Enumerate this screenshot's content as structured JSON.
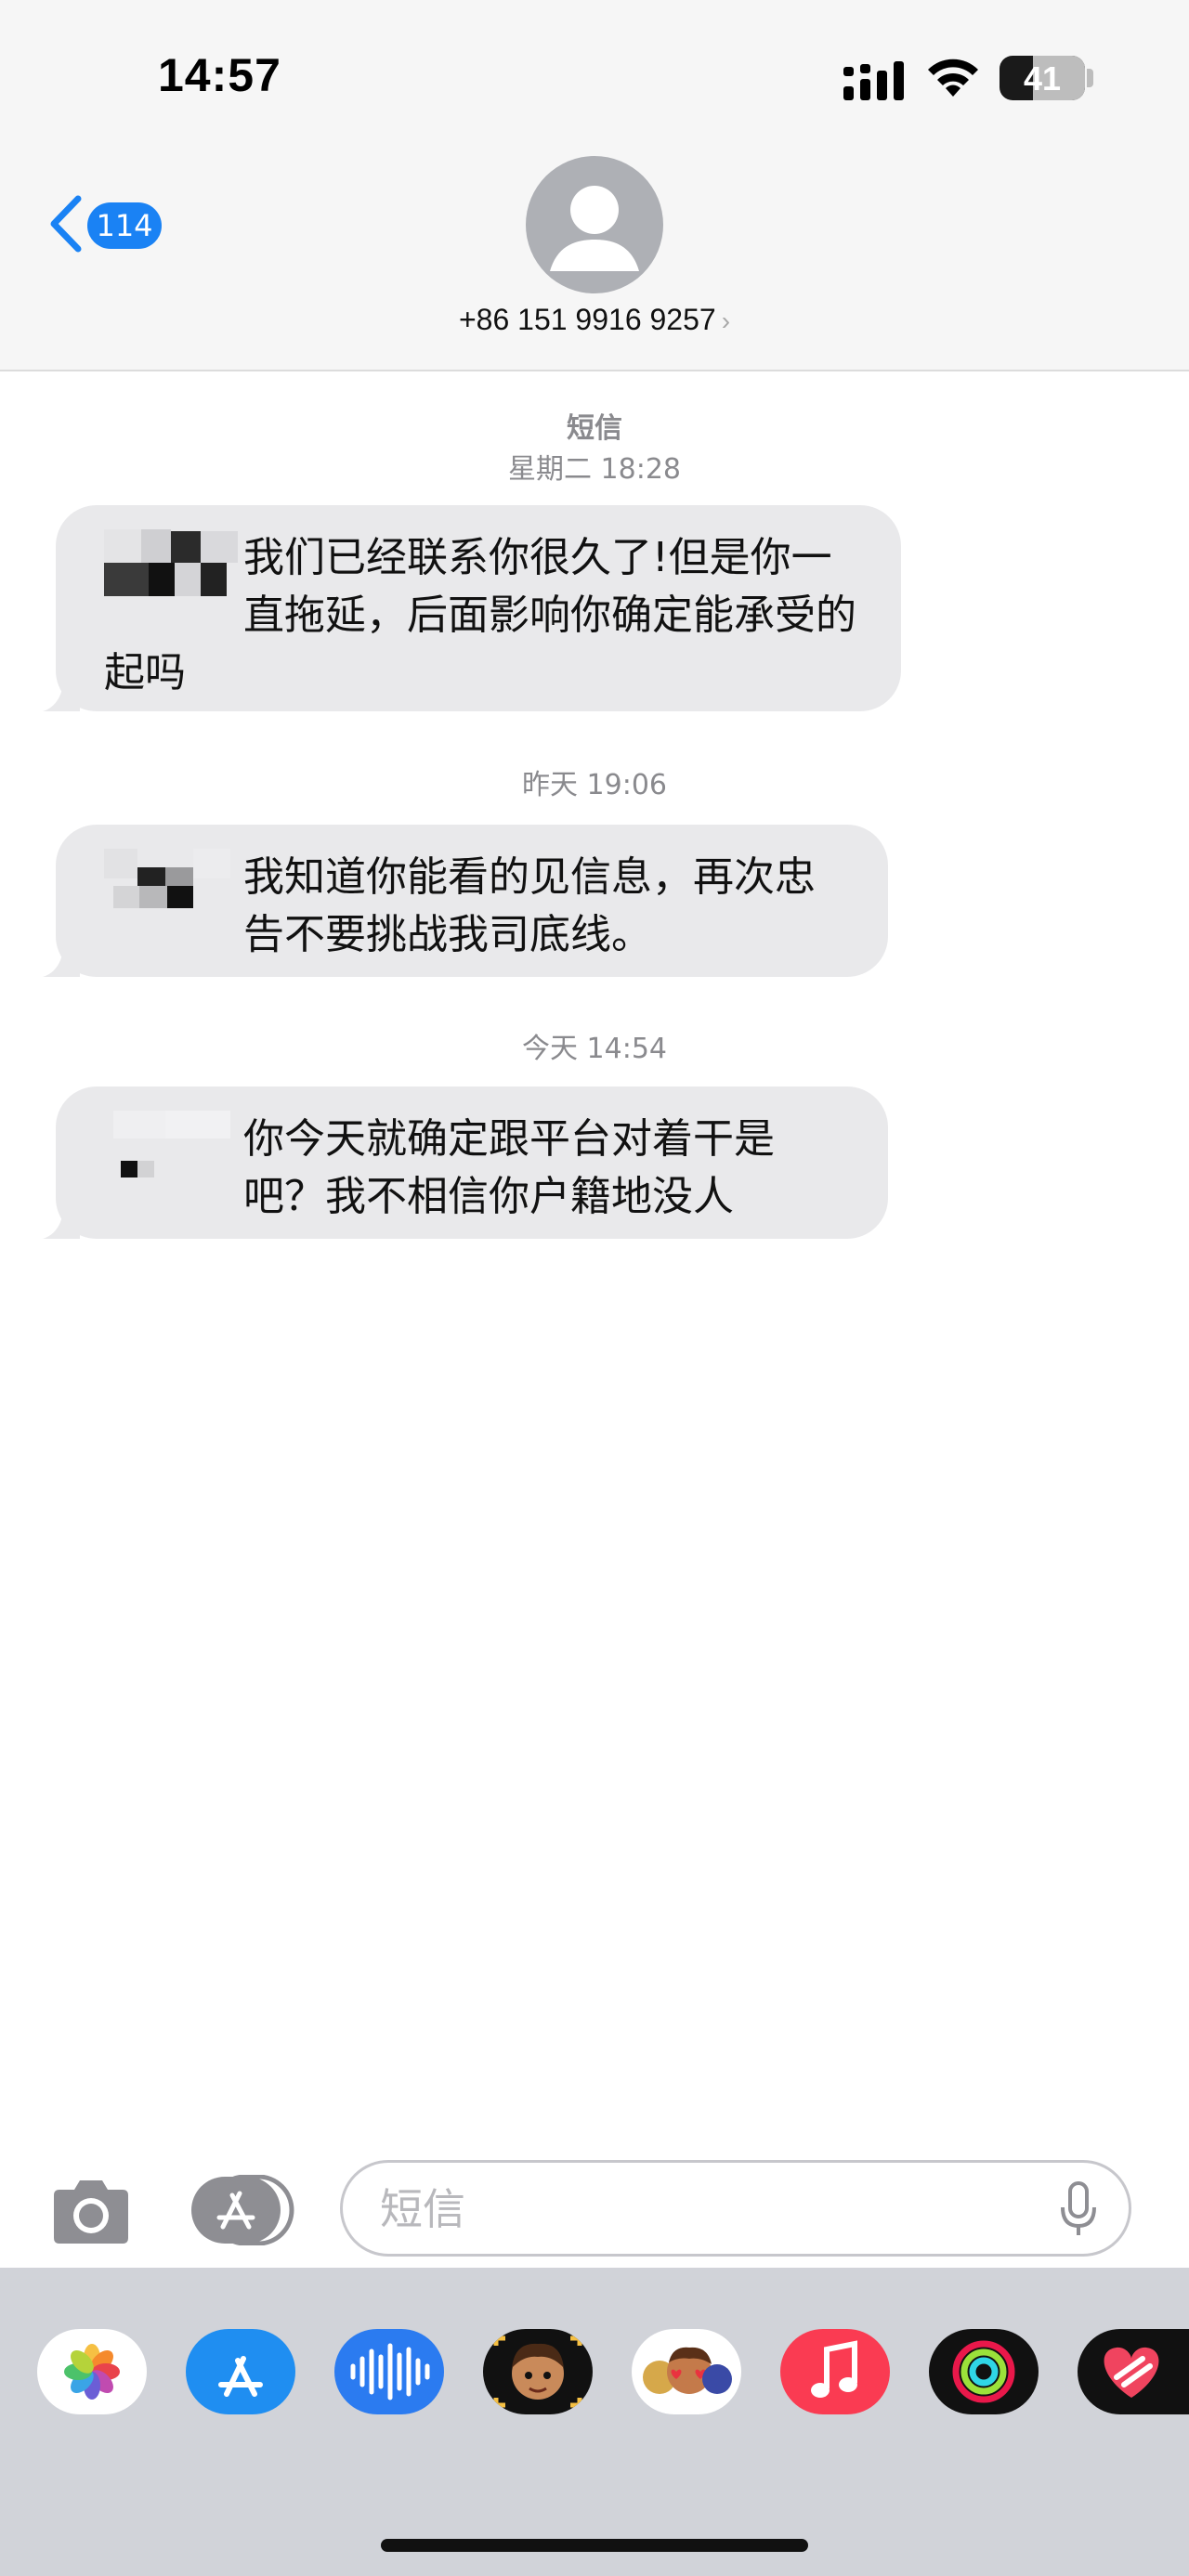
{
  "status_bar": {
    "time": "14:57",
    "battery_level": "41"
  },
  "nav": {
    "back_badge": "114",
    "contact": "+86 151 9916 9257"
  },
  "conversation": {
    "service_label": "短信",
    "groups": [
      {
        "timestamp": "星期二 18:28",
        "message": "我们已经联系你很久了!但是你一直拖延，后面影响你确定能承受的起吗"
      },
      {
        "timestamp": "昨天 19:06",
        "message": "我知道你能看的见信息，再次忠告不要挑战我司底线。"
      },
      {
        "timestamp": "今天 14:54",
        "message": "你今天就确定跟平台对着干是吧？我不相信你户籍地没人"
      }
    ]
  },
  "composer": {
    "placeholder": "短信"
  },
  "app_drawer": {
    "apps": [
      {
        "name": "photos-app",
        "color": "#ffffff"
      },
      {
        "name": "app-store",
        "color": "#1f8ef1"
      },
      {
        "name": "audio-message",
        "color": "#2b7bf0"
      },
      {
        "name": "memoji",
        "color": "#111111"
      },
      {
        "name": "memoji-stickers",
        "color": "#ffffff"
      },
      {
        "name": "music",
        "color": "#fa3b52"
      },
      {
        "name": "fitness",
        "color": "#111111"
      },
      {
        "name": "digital-touch",
        "color": "#111111"
      }
    ]
  }
}
